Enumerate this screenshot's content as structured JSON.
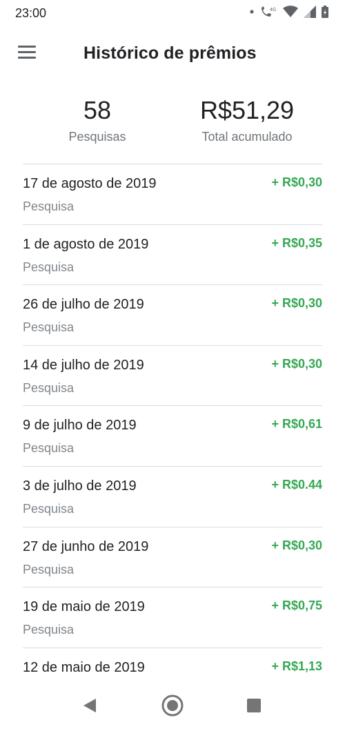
{
  "status_bar": {
    "time": "23:00",
    "icons": [
      "dot-icon",
      "wifi-calling-icon",
      "4g-icon",
      "wifi-icon",
      "signal-icon",
      "battery-icon"
    ],
    "network_label": "4G"
  },
  "app_bar": {
    "title": "Histórico de prêmios",
    "menu_icon": "hamburger-menu-icon"
  },
  "summary": {
    "surveys_count": "58",
    "surveys_label": "Pesquisas",
    "total_value": "R$51,29",
    "total_label": "Total acumulado"
  },
  "rewards": [
    {
      "date": "17 de agosto de 2019",
      "type": "Pesquisa",
      "amount": "+ R$0,30"
    },
    {
      "date": "1 de agosto de 2019",
      "type": "Pesquisa",
      "amount": "+ R$0,35"
    },
    {
      "date": "26 de julho de 2019",
      "type": "Pesquisa",
      "amount": "+ R$0,30"
    },
    {
      "date": "14 de julho de 2019",
      "type": "Pesquisa",
      "amount": "+ R$0,30"
    },
    {
      "date": "9 de julho de 2019",
      "type": "Pesquisa",
      "amount": "+ R$0,61"
    },
    {
      "date": "3 de julho de 2019",
      "type": "Pesquisa",
      "amount": "+ R$0.44"
    },
    {
      "date": "27 de junho de 2019",
      "type": "Pesquisa",
      "amount": "+ R$0,30"
    },
    {
      "date": "19 de maio de 2019",
      "type": "Pesquisa",
      "amount": "+ R$0,75"
    },
    {
      "date": "12 de maio de 2019",
      "type": "",
      "amount": "+ R$1,13"
    }
  ],
  "colors": {
    "amount_green": "#34a853",
    "primary_text": "#202124",
    "secondary_text": "#80868b",
    "divider": "#dadce0"
  },
  "nav_bar": {
    "icons": [
      "back-icon",
      "home-icon",
      "recents-icon"
    ]
  }
}
